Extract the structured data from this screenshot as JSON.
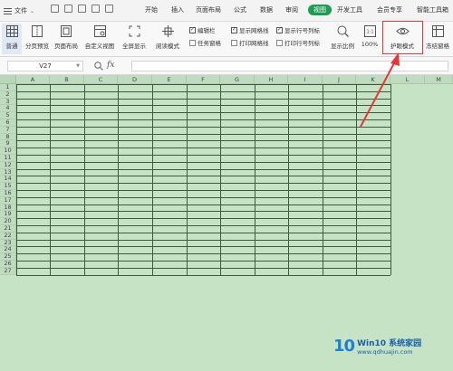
{
  "menubar": {
    "file_label": "文件",
    "tabs": [
      "开始",
      "插入",
      "页面布局",
      "公式",
      "数据",
      "审阅",
      "视图",
      "开发工具",
      "会员专享",
      "智能工具箱"
    ],
    "active_tab": "视图"
  },
  "ribbon": {
    "buttons": [
      {
        "label": "普通",
        "icon": "normal-view-icon"
      },
      {
        "label": "分页预览",
        "icon": "page-break-preview-icon"
      },
      {
        "label": "页面布局",
        "icon": "page-layout-icon"
      },
      {
        "label": "自定义视图",
        "icon": "custom-view-icon"
      },
      {
        "label": "全屏显示",
        "icon": "fullscreen-icon"
      },
      {
        "label": "阅读模式",
        "icon": "reading-mode-icon"
      },
      {
        "label": "显示比例",
        "icon": "zoom-icon"
      },
      {
        "label": "100%",
        "icon": "zoom-100-icon"
      },
      {
        "label": "护眼模式",
        "icon": "eye-icon"
      },
      {
        "label": "冻结窗格",
        "icon": "freeze-panes-icon"
      }
    ],
    "checkboxes": [
      {
        "label": "编辑栏",
        "checked": true
      },
      {
        "label": "任务窗格",
        "checked": false
      },
      {
        "label": "显示网格线",
        "checked": true
      },
      {
        "label": "打印网格线",
        "checked": false
      },
      {
        "label": "显示行号列标",
        "checked": true
      },
      {
        "label": "打印行号列标",
        "checked": false
      }
    ]
  },
  "formula_bar": {
    "cell_ref": "V27",
    "fx": "fx"
  },
  "sheet": {
    "columns": [
      "A",
      "B",
      "C",
      "D",
      "E",
      "F",
      "G",
      "H",
      "I",
      "J",
      "K",
      "L",
      "M"
    ],
    "rows": [
      "1",
      "2",
      "3",
      "4",
      "5",
      "6",
      "7",
      "8",
      "9",
      "10",
      "11",
      "12",
      "13",
      "14",
      "15",
      "16",
      "17",
      "18",
      "19",
      "20",
      "21",
      "22",
      "23",
      "24",
      "25",
      "26",
      "27"
    ],
    "background": "#c6e3c6"
  },
  "annotation": {
    "highlight_color": "#e03a3a"
  },
  "watermark": {
    "logo": "10",
    "title": "Win10 系统家园",
    "url": "www.qdhuajin.com"
  }
}
